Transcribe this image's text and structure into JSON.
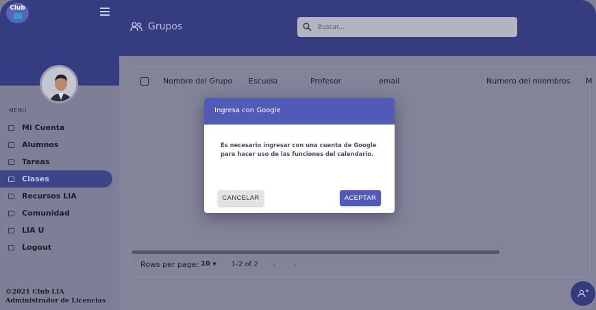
{
  "app": {
    "logo_text": "Club"
  },
  "sidebar": {
    "menu_label": "MENU",
    "items": [
      {
        "label": "Mi Cuenta",
        "icon": "card-icon",
        "active": false
      },
      {
        "label": "Alumnos",
        "icon": "id-icon",
        "active": false
      },
      {
        "label": "Tareas",
        "icon": "clipboard-icon",
        "active": false
      },
      {
        "label": "Clases",
        "icon": "people-icon",
        "active": true
      },
      {
        "label": "Recursos LIA",
        "icon": "list-icon",
        "active": false
      },
      {
        "label": "Comunidad",
        "icon": "chat-icon",
        "active": false
      },
      {
        "label": "LIA U",
        "icon": "grid-icon",
        "active": false
      },
      {
        "label": "Logout",
        "icon": "logout-icon",
        "active": false
      }
    ],
    "footer": "©2021 Club LIA Administrador de Licencias"
  },
  "header": {
    "title": "Grupos",
    "search_placeholder": "Buscar..."
  },
  "table": {
    "columns": [
      "Nombre del Grupo",
      "Escuela",
      "Profesor",
      "email",
      "Numero del miembros",
      "M"
    ],
    "pagination": {
      "rows_label": "Rows per page:",
      "rows_value": "10",
      "range": "1-2 of 2"
    }
  },
  "dialog": {
    "title": "Ingresa con Google",
    "message": "Es necesario ingresar con una cuenta de Google para hacer uso de las funciones del calendario.",
    "cancel_label": "CANCELAR",
    "accept_label": "ACEPTAR"
  },
  "colors": {
    "primary": "#525ab8",
    "sidebar_header": "#343d82",
    "overlay": "#83839a"
  }
}
